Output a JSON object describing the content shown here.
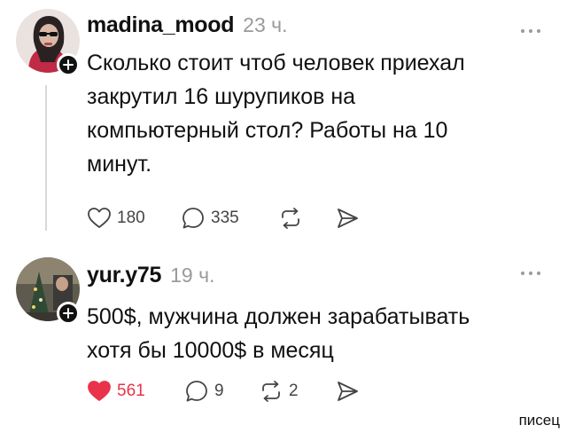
{
  "posts": [
    {
      "username": "madina_mood",
      "time": "23 ч.",
      "text": "Сколько стоит чтоб человек приехал\nзакрутил 16 шурупиков на\nкомпьютерный стол? Работы на 10\nминут.",
      "likes": "180",
      "replies": "335",
      "reposts": "",
      "liked": false,
      "icons": [
        "heart-outline-icon",
        "reply-bubble-icon",
        "repost-icon",
        "share-icon"
      ]
    },
    {
      "username": "yur.y75",
      "time": "19 ч.",
      "text": "500$, мужчина должен зарабатывать\nхотя бы 10000$ в месяц",
      "likes": "561",
      "replies": "9",
      "reposts": "2",
      "liked": true,
      "icons": [
        "heart-filled-icon",
        "reply-bubble-icon",
        "repost-icon",
        "share-icon"
      ]
    }
  ],
  "watermark": "писец",
  "colors": {
    "like_active": "#e8334a",
    "muted": "#9a9a9a",
    "text": "#111111"
  }
}
